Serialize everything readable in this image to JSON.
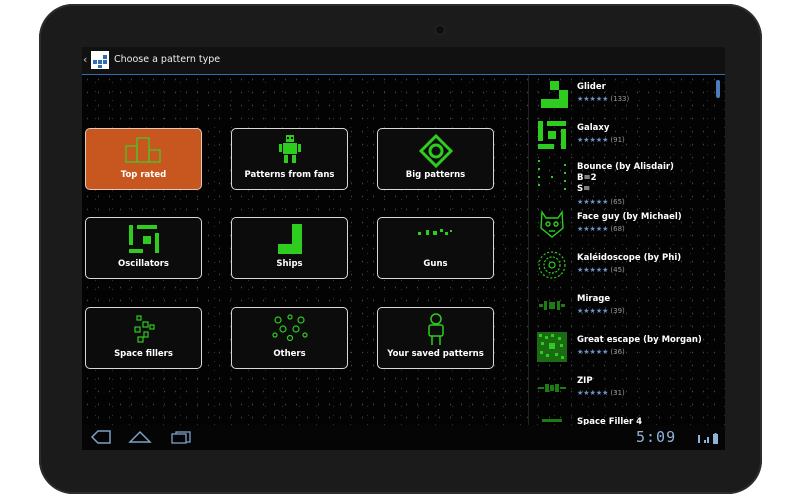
{
  "action_bar": {
    "title": "Choose a pattern type",
    "back_icon": "back-chevron-icon",
    "app_icon": "app-logo-icon"
  },
  "categories": [
    {
      "label": "Top rated",
      "icon": "podium-icon",
      "selected": true
    },
    {
      "label": "Patterns from fans",
      "icon": "robot-icon",
      "selected": false
    },
    {
      "label": "Big patterns",
      "icon": "big-pattern-icon",
      "selected": false
    },
    {
      "label": "Oscillators",
      "icon": "oscillator-icon",
      "selected": false
    },
    {
      "label": "Ships",
      "icon": "ship-icon",
      "selected": false
    },
    {
      "label": "Guns",
      "icon": "gun-icon",
      "selected": false
    },
    {
      "label": "Space fillers",
      "icon": "space-filler-icon",
      "selected": false
    },
    {
      "label": "Others",
      "icon": "others-icon",
      "selected": false
    },
    {
      "label": "Your saved patterns",
      "icon": "person-icon",
      "selected": false
    }
  ],
  "top_rated": [
    {
      "name": "Glider",
      "rating": "★★★★★",
      "count": "(133)",
      "icon": "glider-icon"
    },
    {
      "name": "Galaxy",
      "rating": "★★★★★",
      "count": "(91)",
      "icon": "galaxy-icon"
    },
    {
      "name": "Bounce (by Alisdair)\nB=2\nS=",
      "rating": "★★★★★",
      "count": "(65)",
      "icon": "bounce-icon"
    },
    {
      "name": "Face guy (by Michael)",
      "rating": "★★★★★",
      "count": "(68)",
      "icon": "face-guy-icon"
    },
    {
      "name": "Kaléidoscope (by Phi)",
      "rating": "★★★★★",
      "count": "(45)",
      "icon": "kaleidoscope-icon"
    },
    {
      "name": "Mirage",
      "rating": "★★★★★",
      "count": "(39)",
      "icon": "mirage-icon"
    },
    {
      "name": "Great escape (by Morgan)",
      "rating": "★★★★★",
      "count": "(36)",
      "icon": "great-escape-icon"
    },
    {
      "name": "ZIP",
      "rating": "★★★★★",
      "count": "(31)",
      "icon": "zip-icon"
    },
    {
      "name": "Space Filler 4",
      "rating": "",
      "count": "",
      "icon": "space-filler-4-icon"
    }
  ],
  "system_bar": {
    "time": "5:09",
    "colors": {
      "accent": "#4b7dbd",
      "pattern": "#2ecc1f",
      "selected": "#c8561f"
    }
  }
}
